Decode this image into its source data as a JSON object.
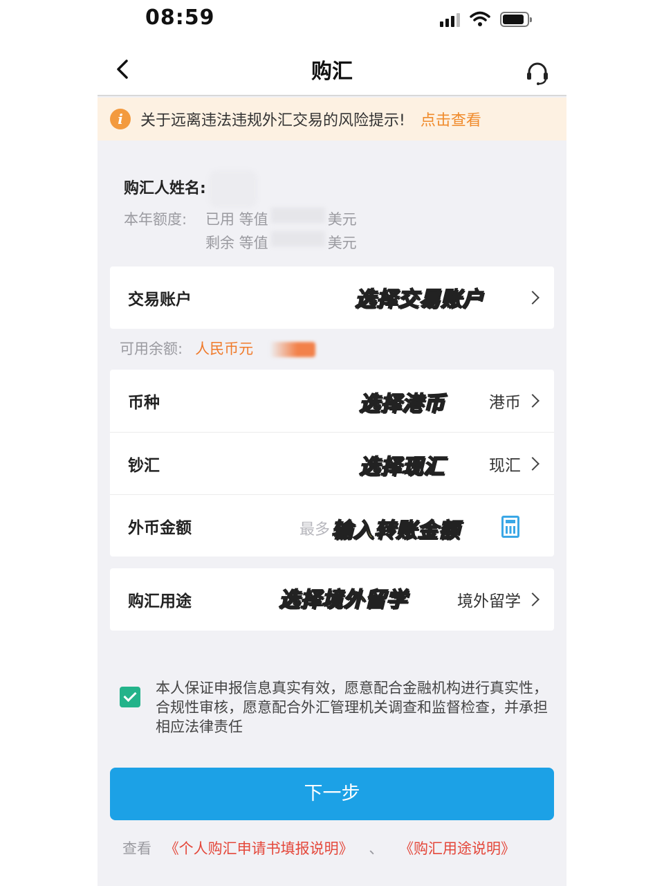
{
  "status_bar": {
    "time": "08:59"
  },
  "nav": {
    "title": "购汇"
  },
  "notice": {
    "text": "关于远离违法违规外汇交易的风险提示!",
    "link": "点击查看"
  },
  "buyer": {
    "name_label": "购汇人姓名:",
    "quota_label": "本年额度:",
    "used_prefix": "已用 等值",
    "used_suffix": "美元",
    "remaining_prefix": "剩余 等值",
    "remaining_suffix": "美元"
  },
  "account": {
    "label": "交易账户",
    "annotation": "选择交易账户"
  },
  "balance": {
    "label": "可用余额:",
    "currency": "人民币元"
  },
  "form": {
    "currency": {
      "label": "币种",
      "annotation": "选择港币",
      "value": "港币"
    },
    "cash_type": {
      "label": "钞汇",
      "annotation": "选择现汇",
      "value": "现汇"
    },
    "amount": {
      "label": "外币金额",
      "placeholder": "最多",
      "annotation": "输入转账金额"
    },
    "purpose": {
      "label": "购汇用途",
      "annotation": "选择境外留学",
      "value": "境外留学"
    }
  },
  "agreement": {
    "checked": true,
    "text": "本人保证申报信息真实有效，愿意配合金融机构进行真实性，合规性审核，愿意配合外汇管理机关调查和监督检查，并承担相应法律责任"
  },
  "next_button": {
    "label": "下一步"
  },
  "footer": {
    "prefix": "查看",
    "link1": "《个人购汇申请书填报说明》",
    "separator": "、",
    "link2": "《购汇用途说明》"
  },
  "colors": {
    "primary": "#1ca1e6",
    "warning": "#f08b2c",
    "check": "#23b38a",
    "link_red": "#e4473a"
  }
}
